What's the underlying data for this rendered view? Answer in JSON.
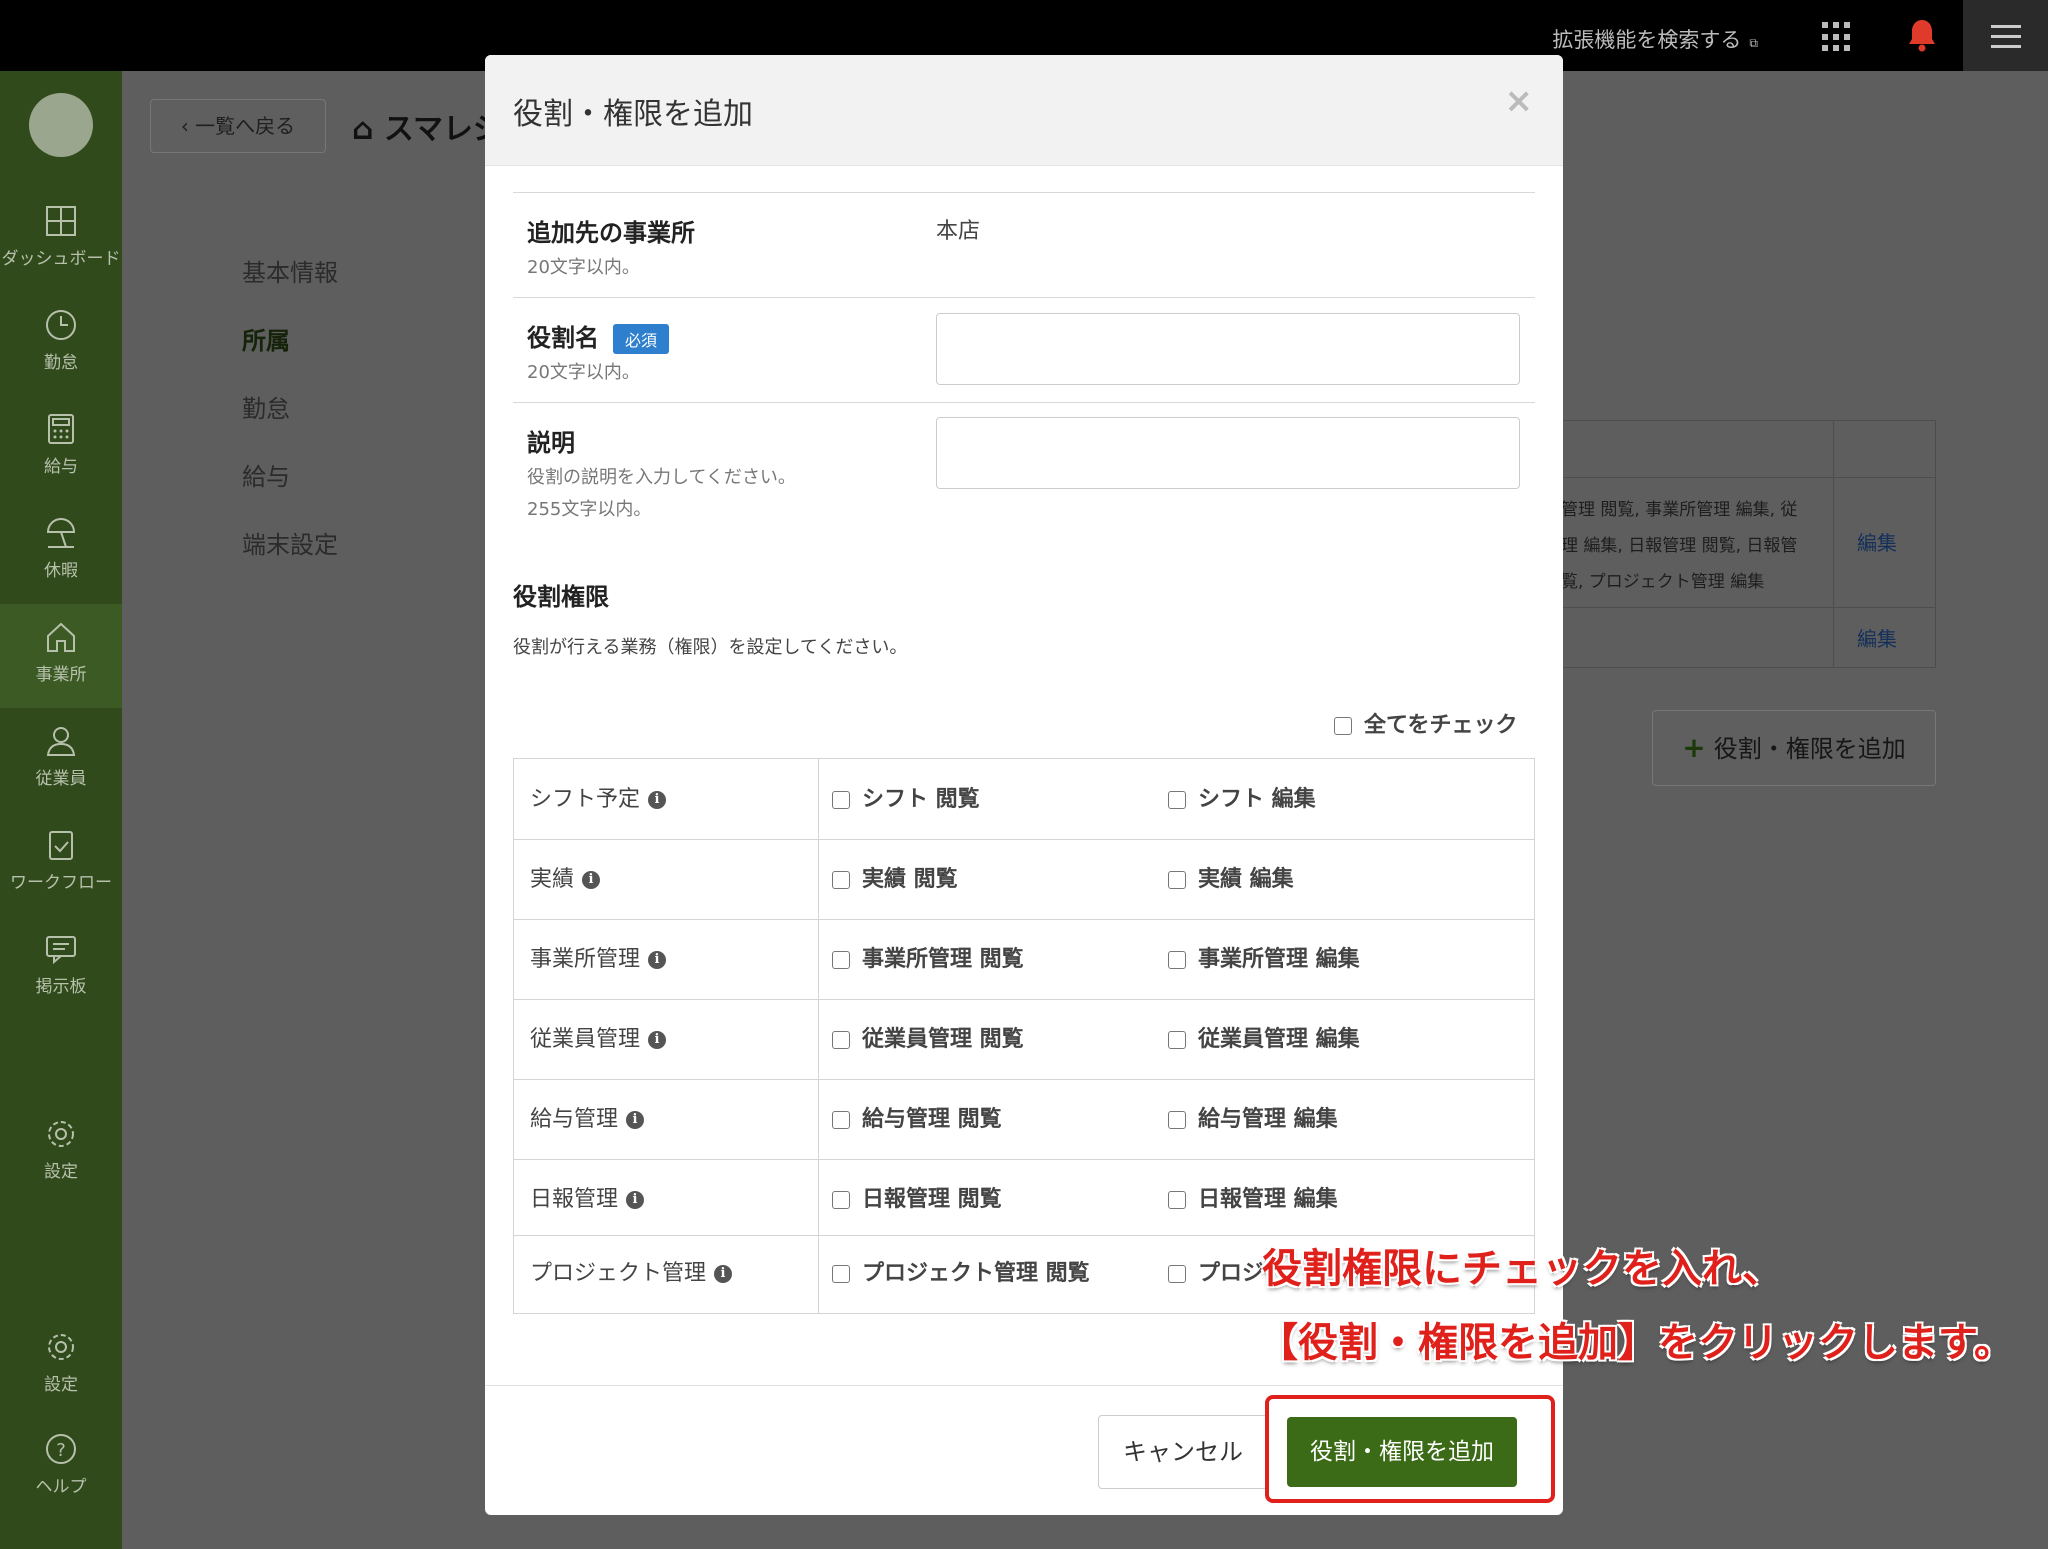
{
  "topbar": {
    "extension_search": "拡張機能を検索する",
    "extension_icon": "external-link-icon"
  },
  "sidebar": {
    "items": [
      {
        "label": "ダッシュボード",
        "icon": "dashboard-icon"
      },
      {
        "label": "勤怠",
        "icon": "clock-icon"
      },
      {
        "label": "給与",
        "icon": "calculator-icon"
      },
      {
        "label": "休暇",
        "icon": "beach-umbrella-icon"
      },
      {
        "label": "事業所",
        "icon": "home-icon",
        "active": true
      },
      {
        "label": "従業員",
        "icon": "user-icon"
      },
      {
        "label": "ワークフロー",
        "icon": "clipboard-check-icon"
      },
      {
        "label": "掲示板",
        "icon": "message-icon"
      },
      {
        "label": "設定",
        "icon": "gear-icon"
      },
      {
        "label": "設定",
        "icon": "gear-icon"
      },
      {
        "label": "ヘルプ",
        "icon": "help-circle-icon"
      }
    ]
  },
  "main": {
    "back_label": "一覧へ戻る",
    "page_title": "スマレジ",
    "subnav": [
      "基本情報",
      "所属",
      "勤怠",
      "給与",
      "端末設定"
    ],
    "subnav_active": "所属",
    "bg_table": {
      "lines": [
        "管理 閲覧, 事業所管理 編集, 従",
        "理 編集, 日報管理 閲覧, 日報管",
        "覧, プロジェクト管理 編集"
      ],
      "edit_label": "編集"
    },
    "add_button_label": "役割・権限を追加"
  },
  "modal": {
    "title": "役割・権限を追加",
    "close": "×",
    "fields": {
      "office": {
        "label": "追加先の事業所",
        "hint": "20文字以内。",
        "value": "本店"
      },
      "role_name": {
        "label": "役割名",
        "required": "必須",
        "hint": "20文字以内。",
        "value": ""
      },
      "description": {
        "label": "説明",
        "hint1": "役割の説明を入力してください。",
        "hint2": "255文字以内。",
        "value": ""
      }
    },
    "permissions": {
      "title": "役割権限",
      "description": "役割が行える業務（権限）を設定してください。",
      "check_all": "全てをチェック",
      "rows": [
        {
          "name": "シフト予定",
          "view": "シフト 閲覧",
          "edit": "シフト 編集"
        },
        {
          "name": "実績",
          "view": "実績 閲覧",
          "edit": "実績 編集"
        },
        {
          "name": "事業所管理",
          "view": "事業所管理 閲覧",
          "edit": "事業所管理 編集"
        },
        {
          "name": "従業員管理",
          "view": "従業員管理 閲覧",
          "edit": "従業員管理 編集"
        },
        {
          "name": "給与管理",
          "view": "給与管理 閲覧",
          "edit": "給与管理 編集"
        },
        {
          "name": "日報管理",
          "view": "日報管理 閲覧",
          "edit": "日報管理 編集"
        },
        {
          "name": "プロジェクト管理",
          "view": "プロジェクト管理 閲覧",
          "edit": "プロジ"
        }
      ]
    },
    "cancel_label": "キャンセル",
    "submit_label": "役割・権限を追加"
  },
  "annotation": {
    "line1": "役割権限にチェックを入れ、",
    "line2": "【役割・権限を追加】をクリックします。",
    "color": "#e0201a"
  }
}
